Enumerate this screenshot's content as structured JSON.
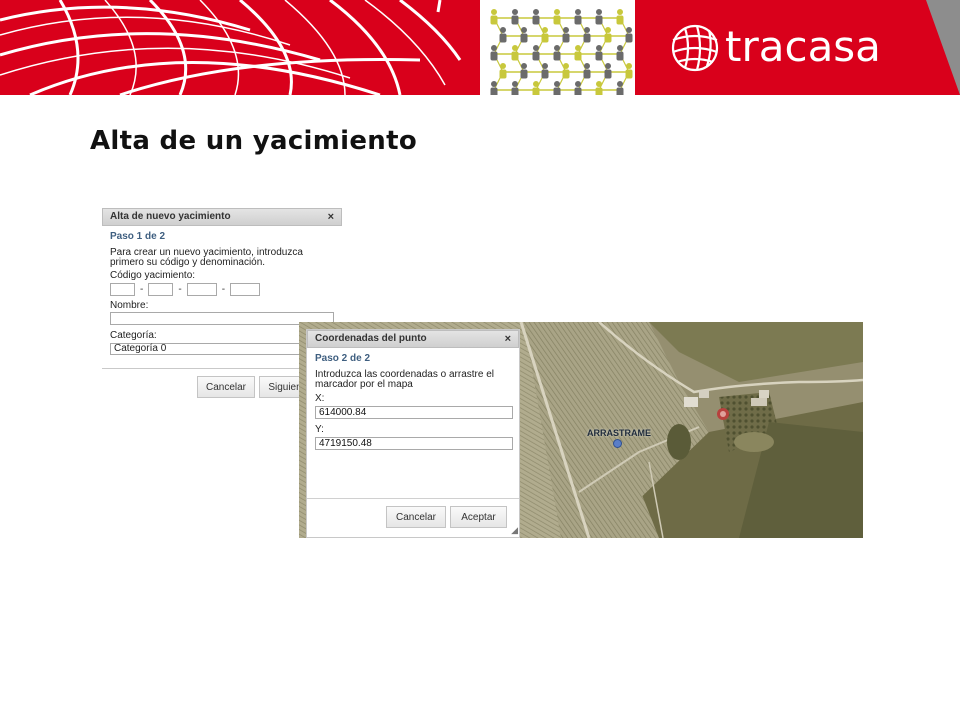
{
  "header": {
    "logo_text": "tracasa",
    "colors": {
      "brand_red": "#d9001b",
      "people_yellow": "#c8c83c",
      "people_gray": "#6b6b6b",
      "corner_gray": "#8d8d8d"
    },
    "icons": [
      "globe-grid-icon",
      "people-network-icon",
      "tracasa-globe-icon"
    ]
  },
  "page": {
    "title": "Alta de un yacimiento"
  },
  "dialog_new_site": {
    "title": "Alta de nuevo yacimiento",
    "close_glyph": "×",
    "step": "Paso 1 de 2",
    "instructions_line1": "Para crear un nuevo yacimiento, introduzca",
    "instructions_line2": "primero su código y denominación.",
    "code_label": "Código yacimiento:",
    "code_separator": "-",
    "name_label": "Nombre:",
    "category_label": "Categoría:",
    "category_value": "Categoría 0",
    "cancel_label": "Cancelar",
    "next_label": "Siguien"
  },
  "dialog_coordinates": {
    "title": "Coordenadas del punto",
    "close_glyph": "×",
    "step": "Paso 2 de 2",
    "instructions_line1": "Introduzca las coordenadas o arrastre el",
    "instructions_line2": "marcador por el mapa",
    "x_label": "X:",
    "x_value": "614000.84",
    "y_label": "Y:",
    "y_value": "4719150.48",
    "cancel_label": "Cancelar",
    "accept_label": "Aceptar",
    "resize_glyph": "◢"
  },
  "map": {
    "marker_label": "ARRASTRAME",
    "marker_color": "#5a7ec8"
  }
}
